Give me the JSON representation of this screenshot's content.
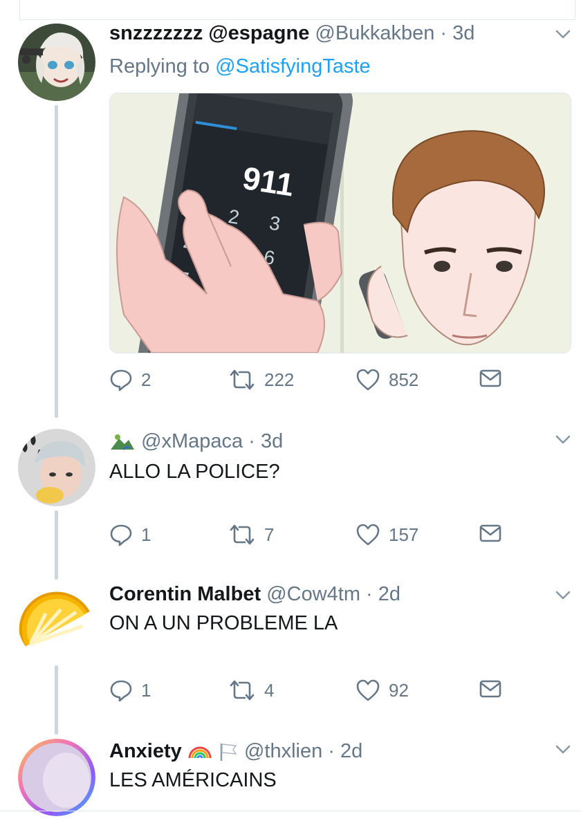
{
  "tweets": [
    {
      "name": "snzzzzzzz @espagne",
      "handle": "@Bukkakben",
      "time": "3d",
      "replying_prefix": "Replying to",
      "replying_to": "@SatisfyingTaste",
      "media_text": "911",
      "actions": {
        "replies": "2",
        "retweets": "222",
        "likes": "852"
      }
    },
    {
      "name": "",
      "handle": "@xMapaca",
      "time": "3d",
      "text": "ALLO LA POLICE?",
      "actions": {
        "replies": "1",
        "retweets": "7",
        "likes": "157"
      }
    },
    {
      "name": "Corentin Malbet",
      "handle": "@Cow4tm",
      "time": "2d",
      "text": "ON A UN PROBLEME LA",
      "actions": {
        "replies": "1",
        "retweets": "4",
        "likes": "92"
      }
    },
    {
      "name": "Anxiety",
      "handle": "@thxlien",
      "time": "2d",
      "text": "LES AMÉRICAINS"
    }
  ],
  "separator": "·",
  "icons": {
    "reply": "reply-icon",
    "retweet": "retweet-icon",
    "like": "heart-icon",
    "dm": "envelope-icon",
    "menu": "chevron-down-icon"
  },
  "colors": {
    "link": "#1da1f2",
    "muted": "#657786",
    "thread_line": "#ccd6dd"
  }
}
